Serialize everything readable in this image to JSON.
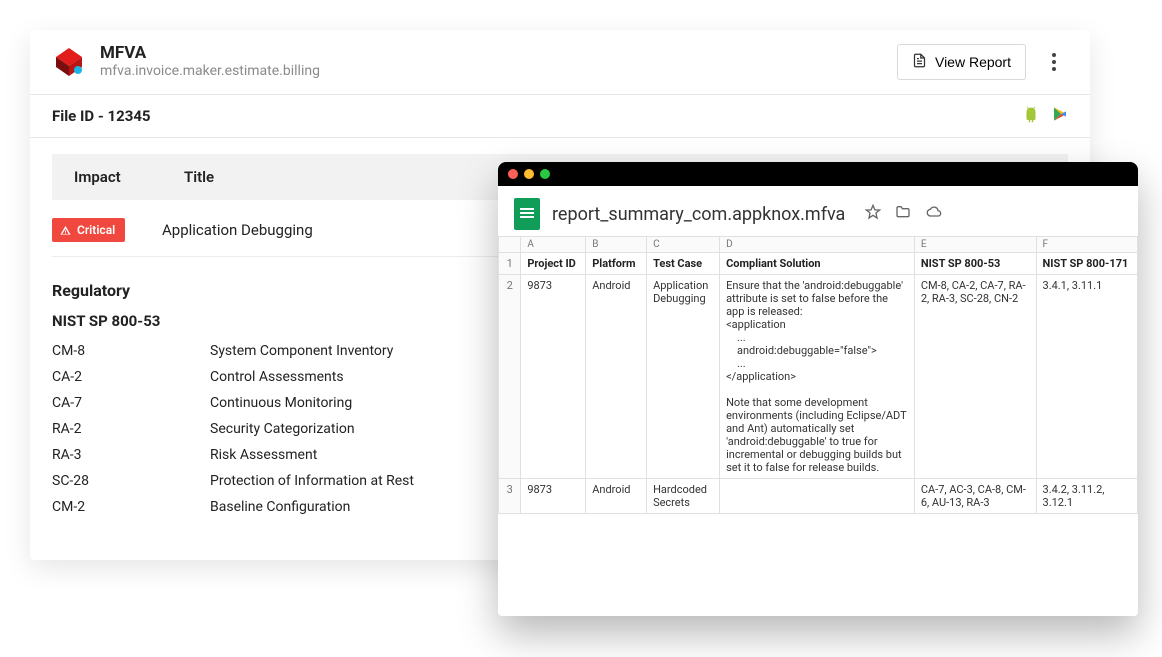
{
  "app": {
    "title": "MFVA",
    "subtitle": "mfva.invoice.maker.estimate.billing",
    "view_report_label": "View Report",
    "file_id_label": "File ID - 12345"
  },
  "table_head": {
    "impact": "Impact",
    "title": "Title"
  },
  "issue": {
    "severity": "Critical",
    "title": "Application Debugging"
  },
  "regulatory": {
    "heading": "Regulatory",
    "standard": "NIST SP 800-53",
    "controls": [
      {
        "code": "CM-8",
        "desc": "System Component Inventory"
      },
      {
        "code": "CA-2",
        "desc": "Control Assessments"
      },
      {
        "code": "CA-7",
        "desc": "Continuous Monitoring"
      },
      {
        "code": "RA-2",
        "desc": "Security Categorization"
      },
      {
        "code": "RA-3",
        "desc": "Risk Assessment"
      },
      {
        "code": "SC-28",
        "desc": "Protection of Information at Rest"
      },
      {
        "code": "CM-2",
        "desc": "Baseline Configuration"
      }
    ]
  },
  "sheet": {
    "filename": "report_summary_com.appknox.mfva",
    "col_letters": [
      "A",
      "B",
      "C",
      "D",
      "E",
      "F"
    ],
    "headers": [
      "Project ID",
      "Platform",
      "Test Case",
      "Compliant Solution",
      "NIST SP 800-53",
      "NIST SP 800-171"
    ],
    "rows": [
      {
        "row_no": "2",
        "project_id": "9873",
        "platform": "Android",
        "test_case": "Application Debugging",
        "solution": "Ensure that the 'android:debuggable' attribute is set to false before the app is released:\n<application\n    ...\n    android:debuggable=\"false\">\n    ...\n</application>\n\nNote that some development environments (including Eclipse/ADT and Ant) automatically set 'android:debuggable' to true for incremental or debugging builds but set it to false for release builds.",
        "nist53": "CM-8, CA-2, CA-7, RA-2, RA-3, SC-28, CN-2",
        "nist171": "3.4.1, 3.11.1"
      },
      {
        "row_no": "3",
        "project_id": "9873",
        "platform": "Android",
        "test_case": "Hardcoded Secrets",
        "solution": "",
        "nist53": "CA-7, AC-3, CA-8, CM-6, AU-13, RA-3",
        "nist171": "3.4.2, 3.11.2, 3.12.1"
      }
    ]
  },
  "colors": {
    "critical": "#f0483e",
    "sheets_green": "#0f9d58",
    "traffic_red": "#ff5f57",
    "traffic_yellow": "#febc2e",
    "traffic_green": "#28c840"
  }
}
